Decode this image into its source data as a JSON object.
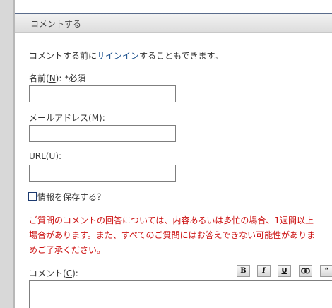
{
  "section": {
    "title": "コメントする"
  },
  "signin": {
    "prefix": "コメントする前に",
    "link": "サインイン",
    "suffix": "することもできます。"
  },
  "form": {
    "name": {
      "label_pre": "名前(",
      "access_key": "N",
      "label_post": "): *必須",
      "value": ""
    },
    "email": {
      "label_pre": "メールアドレス(",
      "access_key": "M",
      "label_post": "):",
      "value": ""
    },
    "url": {
      "label_pre": "URL(",
      "access_key": "U",
      "label_post": "):",
      "value": ""
    },
    "remember": {
      "label": "情報を保存する？",
      "checked": false
    }
  },
  "notice": {
    "lines": [
      "ご質問のコメントの回答については、内容あるいは多忙の場合、1週間以上",
      "場合があります。また、すべてのご質問にはお答えできない可能性がありま",
      "めご了承ください。"
    ]
  },
  "comment": {
    "label_pre": "コメント(",
    "access_key": "C",
    "label_post": "):",
    "value": "",
    "toolbar": {
      "bold": "B",
      "italic": "I",
      "underline": "U",
      "quote": "“"
    }
  }
}
